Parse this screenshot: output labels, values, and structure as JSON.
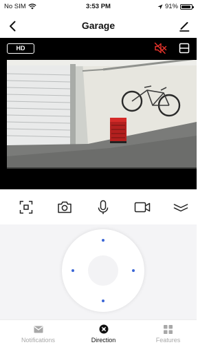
{
  "status_bar": {
    "carrier": "No SIM",
    "time": "3:53 PM",
    "battery": "91%",
    "battery_level": 0.91
  },
  "nav": {
    "title": "Garage"
  },
  "video": {
    "quality_badge": "HD",
    "accent": "#e3322a"
  },
  "controls": {
    "items": [
      {
        "name": "fullscreen-icon"
      },
      {
        "name": "camera-icon"
      },
      {
        "name": "microphone-icon"
      },
      {
        "name": "video-record-icon"
      },
      {
        "name": "collapse-icon"
      }
    ]
  },
  "ptz": {
    "dot_color": "#3a66d6"
  },
  "tabs": [
    {
      "label": "Notifications",
      "icon": "mail-icon",
      "active": false
    },
    {
      "label": "Direction",
      "icon": "direction-icon",
      "active": true
    },
    {
      "label": "Features",
      "icon": "grid-icon",
      "active": false
    }
  ]
}
